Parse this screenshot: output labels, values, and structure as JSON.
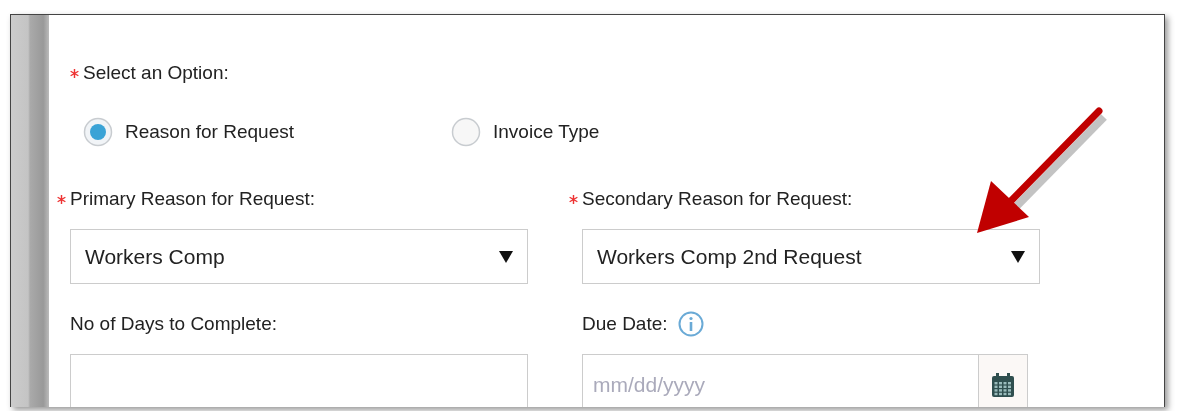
{
  "option_group": {
    "label": "Select an Option:",
    "required": true,
    "options": [
      {
        "label": "Reason for Request",
        "selected": true
      },
      {
        "label": "Invoice Type",
        "selected": false
      }
    ]
  },
  "fields": [
    {
      "kind": "select",
      "label": "Primary Reason for Request:",
      "required": true,
      "value": "Workers Comp"
    },
    {
      "kind": "select",
      "label": "Secondary Reason for Request:",
      "required": true,
      "value": "Workers Comp 2nd Request"
    },
    {
      "kind": "text",
      "label": "No of Days to Complete:",
      "required": false
    },
    {
      "kind": "date",
      "label": "Due Date:",
      "required": false,
      "info": true,
      "placeholder": "mm/dd/yyyy"
    }
  ]
}
